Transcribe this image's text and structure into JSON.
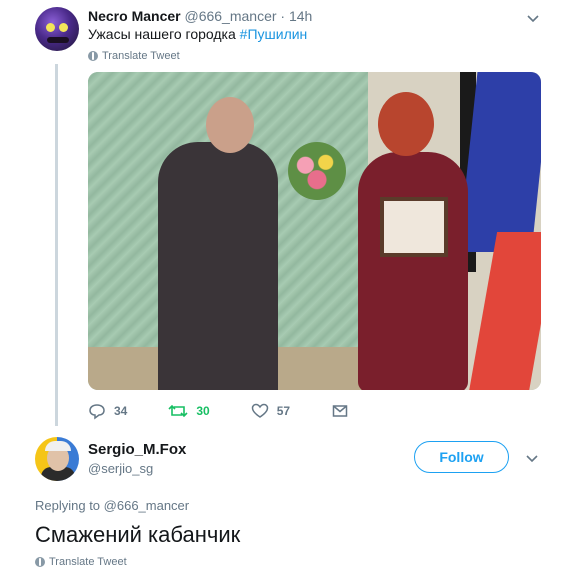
{
  "tweet1": {
    "author_name": "Necro Mancer",
    "author_handle": "@666_mancer",
    "time": "· 14h",
    "text": "Ужасы нашего городка ",
    "hashtag": "#Пушилин",
    "translate": "Translate Tweet",
    "actions": {
      "replies": "34",
      "retweets": "30",
      "likes": "57"
    }
  },
  "tweet2": {
    "author_name": "Sergio_M.Fox",
    "author_handle": "@serjio_sg",
    "follow_label": "Follow",
    "replying_to_label": "Replying to ",
    "replying_to_handle": "@666_mancer",
    "text": "Смажений кабанчик",
    "translate": "Translate Tweet"
  },
  "colors": {
    "accent": "#1da1f2",
    "retweet": "#17bf63",
    "muted": "#657786"
  },
  "icons": [
    "reply-icon",
    "retweet-icon",
    "like-icon",
    "share-icon",
    "chevron-down-icon",
    "globe-icon"
  ]
}
